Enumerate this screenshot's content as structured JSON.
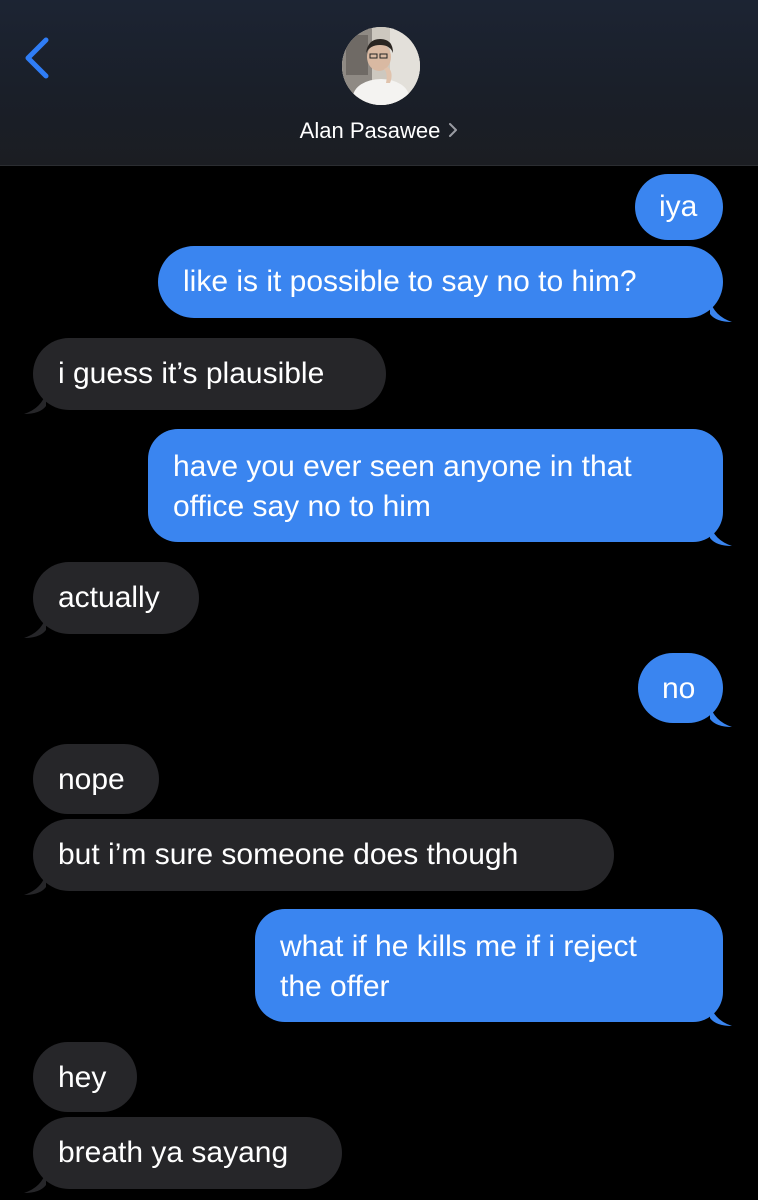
{
  "contact": {
    "name": "Alan Pasawee",
    "chevron_icon": "chevron-right-icon",
    "back_icon": "chevron-left-icon"
  },
  "colors": {
    "outgoing": "#3a85f0",
    "incoming": "#262629",
    "accent": "#2f7df6",
    "background": "#000000"
  },
  "messages": [
    {
      "from": "me",
      "text": "iya"
    },
    {
      "from": "me",
      "text": "like is it possible to say no to him?"
    },
    {
      "from": "them",
      "text": "i guess it’s plausible"
    },
    {
      "from": "me",
      "lines": [
        "have you ever seen anyone in that",
        "office say no to him"
      ]
    },
    {
      "from": "them",
      "text": "actually"
    },
    {
      "from": "me",
      "text": "no"
    },
    {
      "from": "them",
      "text": "nope"
    },
    {
      "from": "them",
      "text": "but i’m sure someone does though"
    },
    {
      "from": "me",
      "lines": [
        "what if he kills me if i reject",
        "the offer"
      ]
    },
    {
      "from": "them",
      "text": "hey"
    },
    {
      "from": "them",
      "text": "breath ya sayang"
    }
  ]
}
